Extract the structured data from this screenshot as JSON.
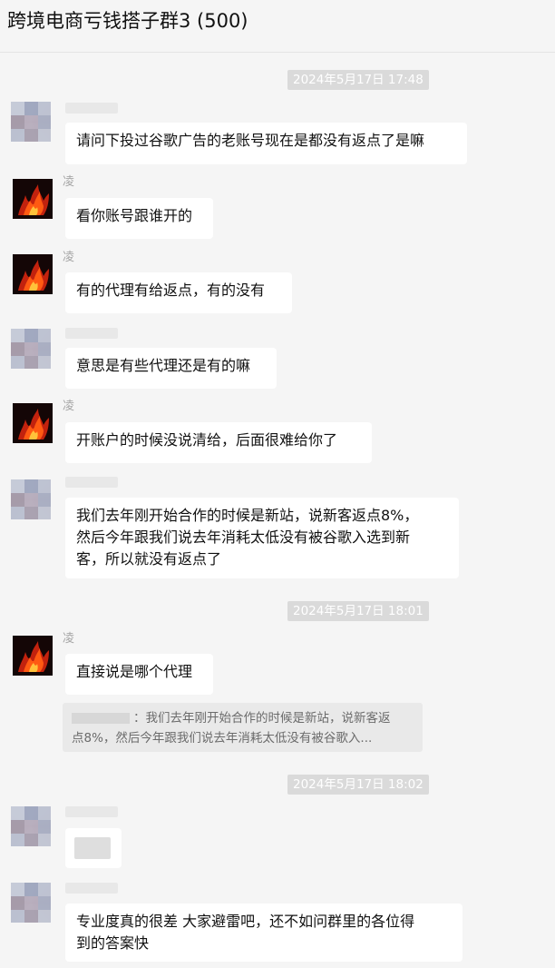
{
  "chat": {
    "title": "跨境电商亏钱搭子群3 (500)"
  },
  "timestamps": [
    "2024年5月17日 17:48",
    "2024年5月17日 18:01",
    "2024年5月17日 18:02"
  ],
  "sender_ling": "凌",
  "messages": [
    {
      "text": "请问下投过谷歌广告的老账号现在是都没有返点了是嘛"
    },
    {
      "text": "看你账号跟谁开的"
    },
    {
      "text": "有的代理有给返点，有的没有"
    },
    {
      "text": "意思是有些代理还是有的嘛"
    },
    {
      "text": "开账户的时候没说清给，后面很难给你了"
    },
    {
      "lines": [
        "我们去年刚开始合作的时候是新站，说新客返点8%，",
        "然后今年跟我们说去年消耗太低没有被谷歌入选到新",
        "客，所以就没有返点了"
      ]
    },
    {
      "text": "直接说是哪个代理"
    },
    {
      "text": "专业度真的很差  大家避雷吧，还不如问群里的各位得",
      "text2": "到的答案快"
    }
  ],
  "quote": {
    "line1": "：我们去年刚开始合作的时候是新站，说新客返",
    "line2": "点8%，然后今年跟我们说去年消耗太低没有被谷歌入..."
  }
}
